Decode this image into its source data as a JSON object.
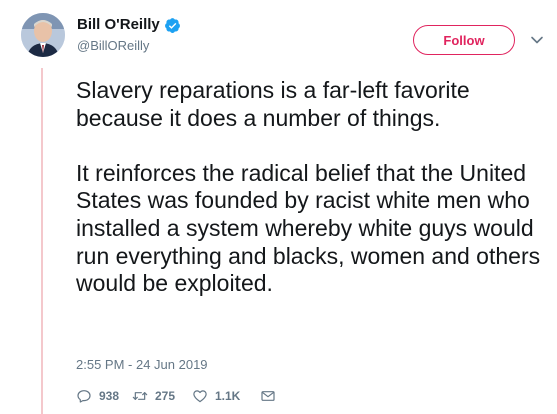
{
  "author": {
    "display_name": "Bill O'Reilly",
    "handle": "@BillOReilly",
    "verified": true
  },
  "follow_button": {
    "label": "Follow"
  },
  "tweet": {
    "text": "Slavery reparations is a far-left favorite because it does a number of things.\n\nIt reinforces the radical belief that the United States was founded by racist white men who installed a system whereby white guys would run everything and blacks, women and others would be exploited.",
    "timestamp": "2:55 PM - 24 Jun 2019"
  },
  "actions": {
    "replies": "938",
    "retweets": "275",
    "likes": "1.1K"
  },
  "icons": {
    "verified": "verified-badge-icon",
    "more": "chevron-down-icon",
    "reply": "reply-icon",
    "retweet": "retweet-icon",
    "like": "heart-icon",
    "message": "envelope-icon"
  },
  "colors": {
    "follow_accent": "#e0245e",
    "verified_blue": "#1da1f2",
    "thread_line": "#f4c8cc",
    "secondary_text": "#657786"
  }
}
